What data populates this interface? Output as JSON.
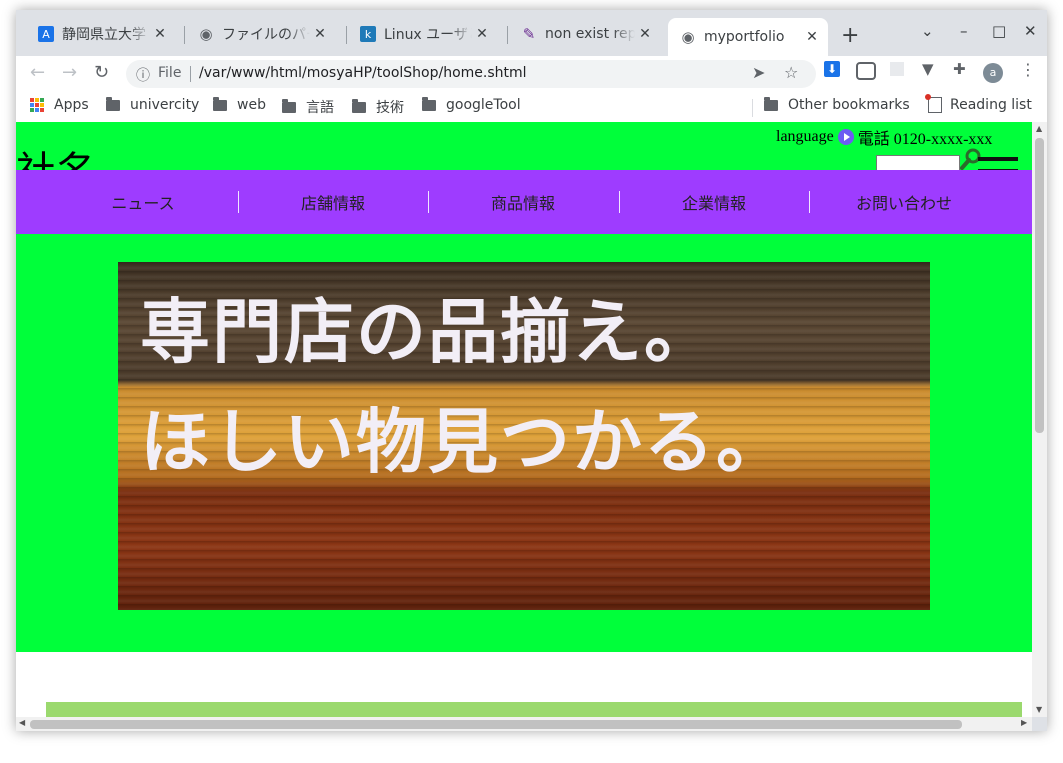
{
  "browser": {
    "tabs": [
      {
        "title": "静岡県立大学",
        "icon": "a-letter-icon",
        "color": "#1a73e8",
        "icon_text": "A"
      },
      {
        "title": "ファイルのパー",
        "icon": "globe-icon",
        "color": "#5f6368",
        "icon_text": "◉"
      },
      {
        "title": "Linux ユーザと",
        "icon": "k-letter-icon",
        "color": "#1f7ab8",
        "icon_text": "k"
      },
      {
        "title": "non exist repa",
        "icon": "pen-icon",
        "color": "#6a2c91",
        "icon_text": "✎"
      },
      {
        "title": "myportfolio",
        "icon": "globe-icon",
        "color": "#5f6368",
        "icon_text": "◉"
      }
    ],
    "active_tab_index": 4,
    "new_tab_symbol": "+",
    "window_controls": {
      "tab_search": "⌄",
      "minimize": "–",
      "maximize": "□",
      "close": "✕"
    },
    "toolbar": {
      "back": "←",
      "forward": "→",
      "reload": "↻",
      "site_info": "ⓘ",
      "scheme_label": "File",
      "url": "/var/www/html/mosyaHP/toolShop/home.shtml",
      "send_icon": "➤",
      "star_icon": "☆",
      "avatar_letter": "a"
    },
    "bookmarks": {
      "apps": "Apps",
      "folders": [
        "univercity",
        "web",
        "言語",
        "技術",
        "googleTool"
      ],
      "other": "Other bookmarks",
      "reading_list": "Reading list"
    }
  },
  "site": {
    "company_name": "社名",
    "language_label": "language",
    "phone_label": "電話 0120-xxxx-xxx",
    "search_placeholder": "",
    "nav": [
      "ニュース",
      "店舗情報",
      "商品情報",
      "企業情報",
      "お問い合わせ"
    ],
    "banner": {
      "line1": "専門店の品揃え。",
      "line2": "ほしい物見つかる。"
    },
    "colors": {
      "header_bg": "#00ff3a",
      "nav_bg": "#9e3cff",
      "strip": "#9bd96e"
    }
  }
}
